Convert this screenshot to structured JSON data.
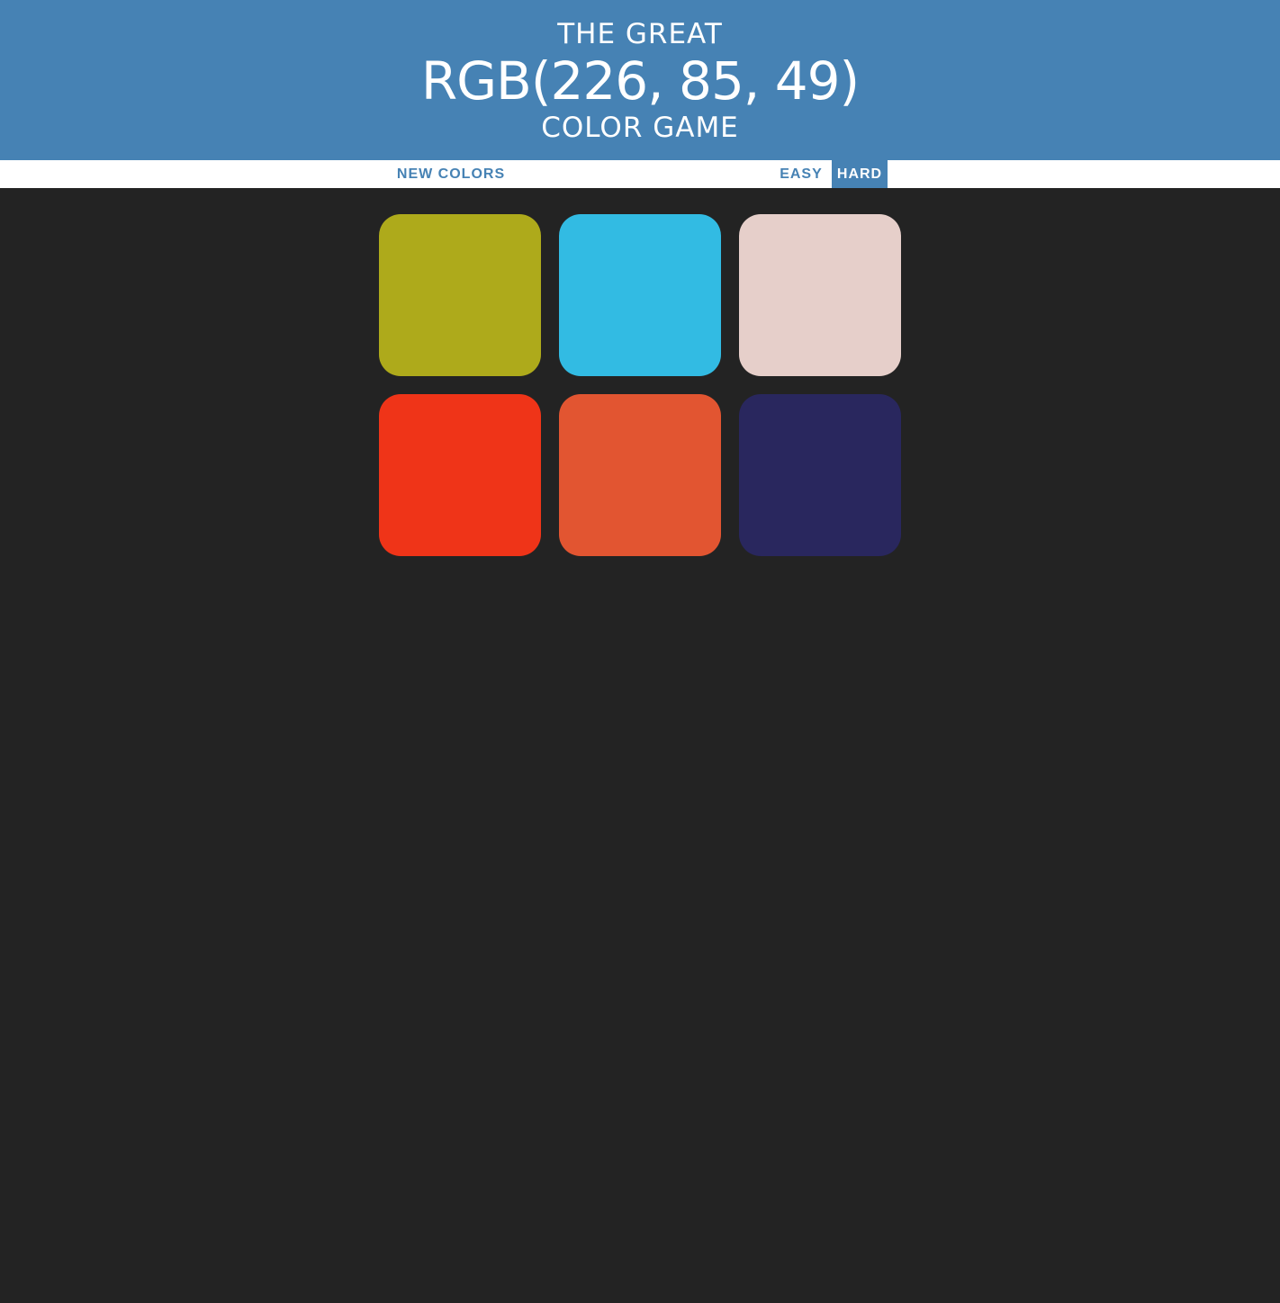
{
  "header": {
    "line1": "THE GREAT",
    "target_rgb": "RGB(226, 85, 49)",
    "line3": "COLOR GAME",
    "background_color": "#4682b4"
  },
  "stripe": {
    "new_colors_label": "NEW COLORS",
    "message": "",
    "easy_label": "EASY",
    "hard_label": "HARD",
    "selected_mode": "HARD"
  },
  "squares": [
    {
      "color": "#aeaa1b"
    },
    {
      "color": "#32bbe3"
    },
    {
      "color": "#e6cfca"
    },
    {
      "color": "#ef3418"
    },
    {
      "color": "#e25531"
    },
    {
      "color": "#29275e"
    }
  ],
  "page_background": "#232323"
}
